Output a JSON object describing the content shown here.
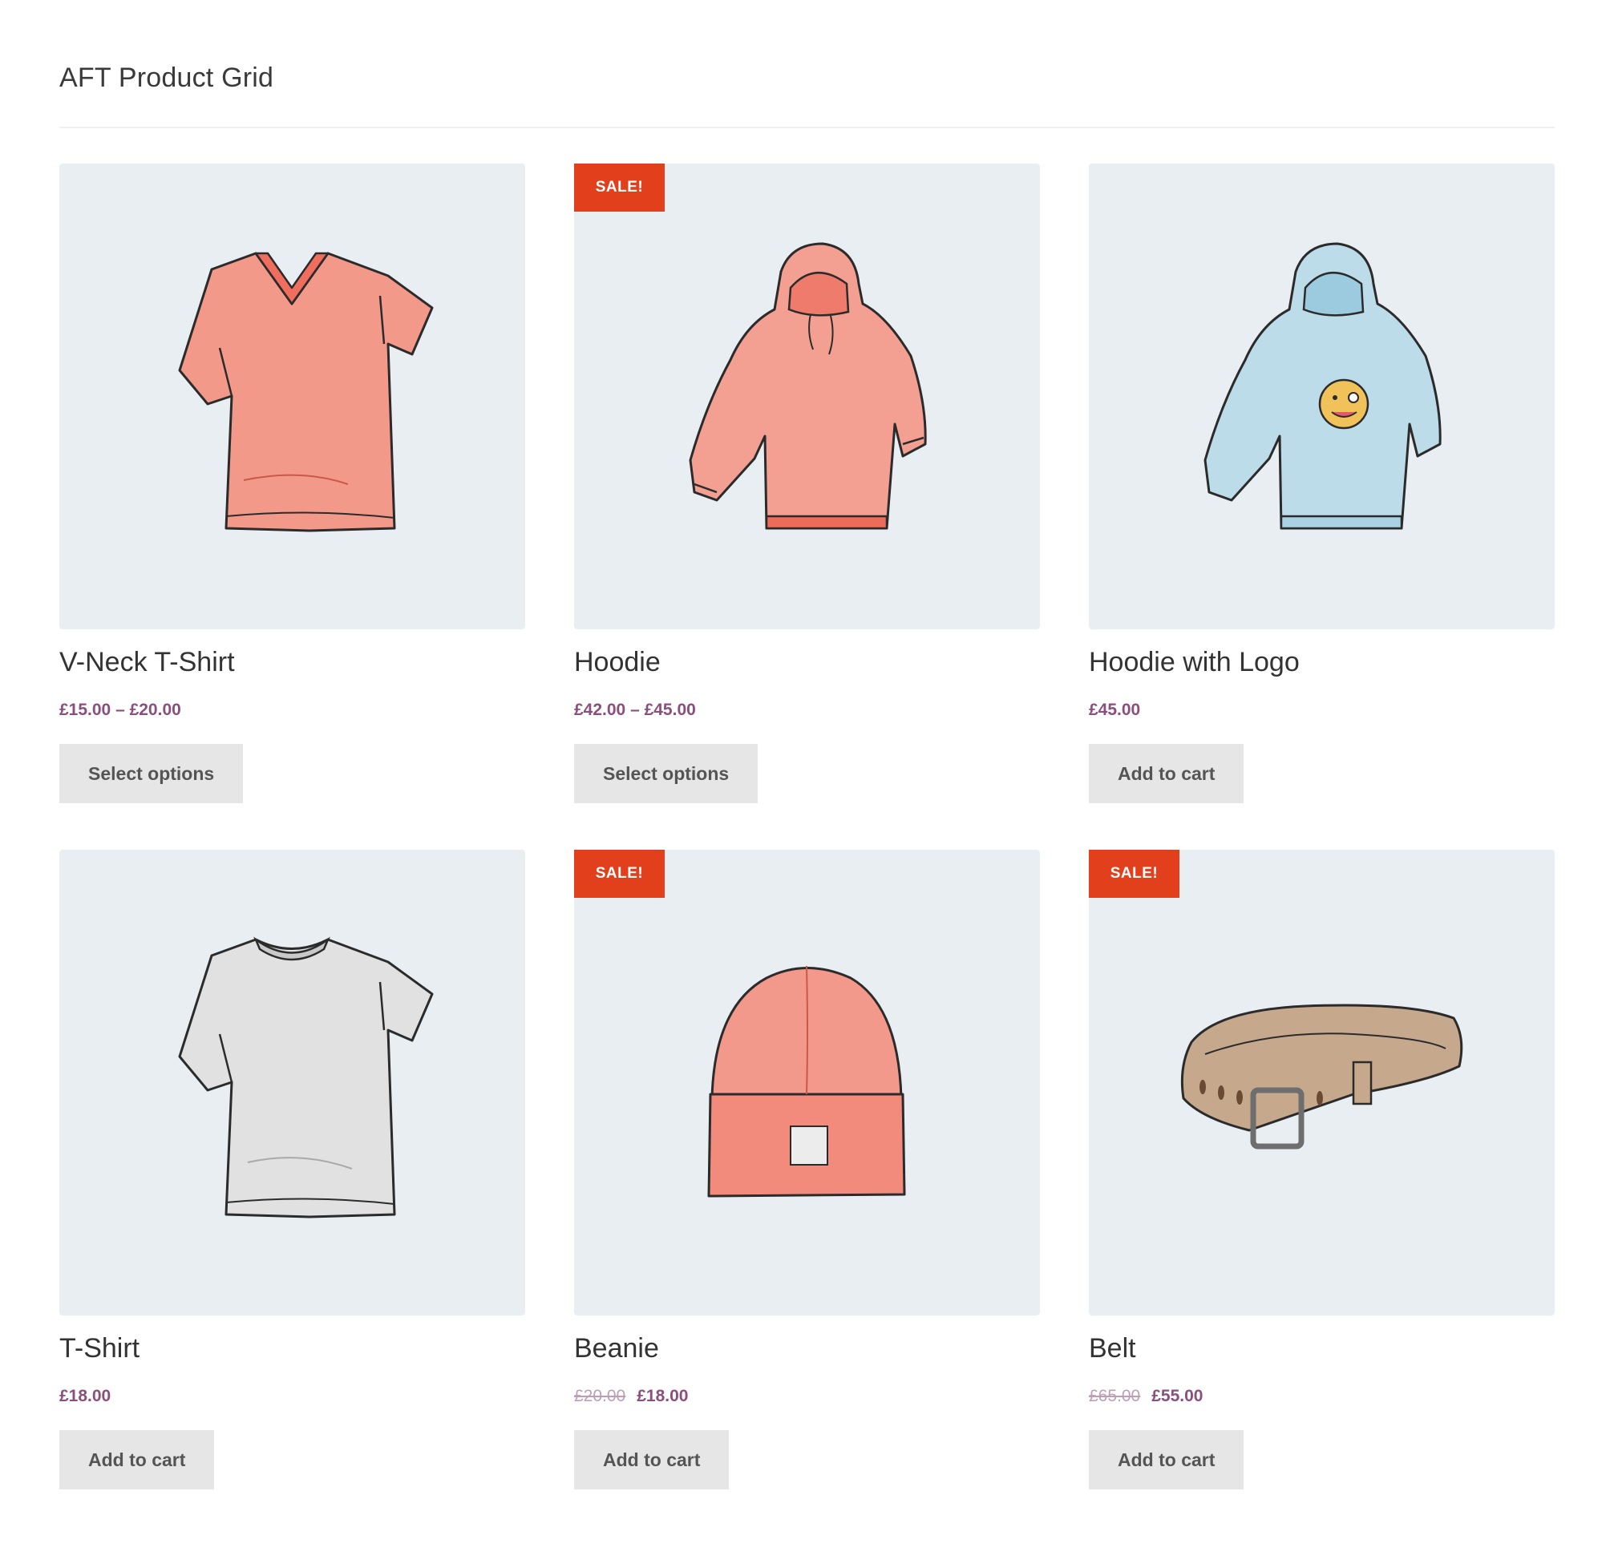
{
  "page": {
    "title": "AFT Product Grid"
  },
  "colors": {
    "thumb_bg": "#e9eef3",
    "sale_badge": "#e2401c",
    "price": "#8a4f7d",
    "button_bg": "#e6e6e6",
    "coral": "#f08a7a",
    "light_blue": "#b9dbe9",
    "grey": "#d8d8d8",
    "tan": "#b89a80"
  },
  "products": [
    {
      "name": "V-Neck T-Shirt",
      "image_icon": "vneck-tshirt-icon",
      "sale": false,
      "sale_label": "",
      "price_old": "",
      "price": "£15.00 – £20.00",
      "button": "Select options"
    },
    {
      "name": "Hoodie",
      "image_icon": "hoodie-icon",
      "sale": true,
      "sale_label": "SALE!",
      "price_old": "",
      "price": "£42.00 – £45.00",
      "button": "Select options"
    },
    {
      "name": "Hoodie with Logo",
      "image_icon": "hoodie-logo-icon",
      "sale": false,
      "sale_label": "",
      "price_old": "",
      "price": "£45.00",
      "button": "Add to cart"
    },
    {
      "name": "T-Shirt",
      "image_icon": "tshirt-icon",
      "sale": false,
      "sale_label": "",
      "price_old": "",
      "price": "£18.00",
      "button": "Add to cart"
    },
    {
      "name": "Beanie",
      "image_icon": "beanie-icon",
      "sale": true,
      "sale_label": "SALE!",
      "price_old": "£20.00",
      "price": "£18.00",
      "button": "Add to cart"
    },
    {
      "name": "Belt",
      "image_icon": "belt-icon",
      "sale": true,
      "sale_label": "SALE!",
      "price_old": "£65.00",
      "price": "£55.00",
      "button": "Add to cart"
    }
  ]
}
